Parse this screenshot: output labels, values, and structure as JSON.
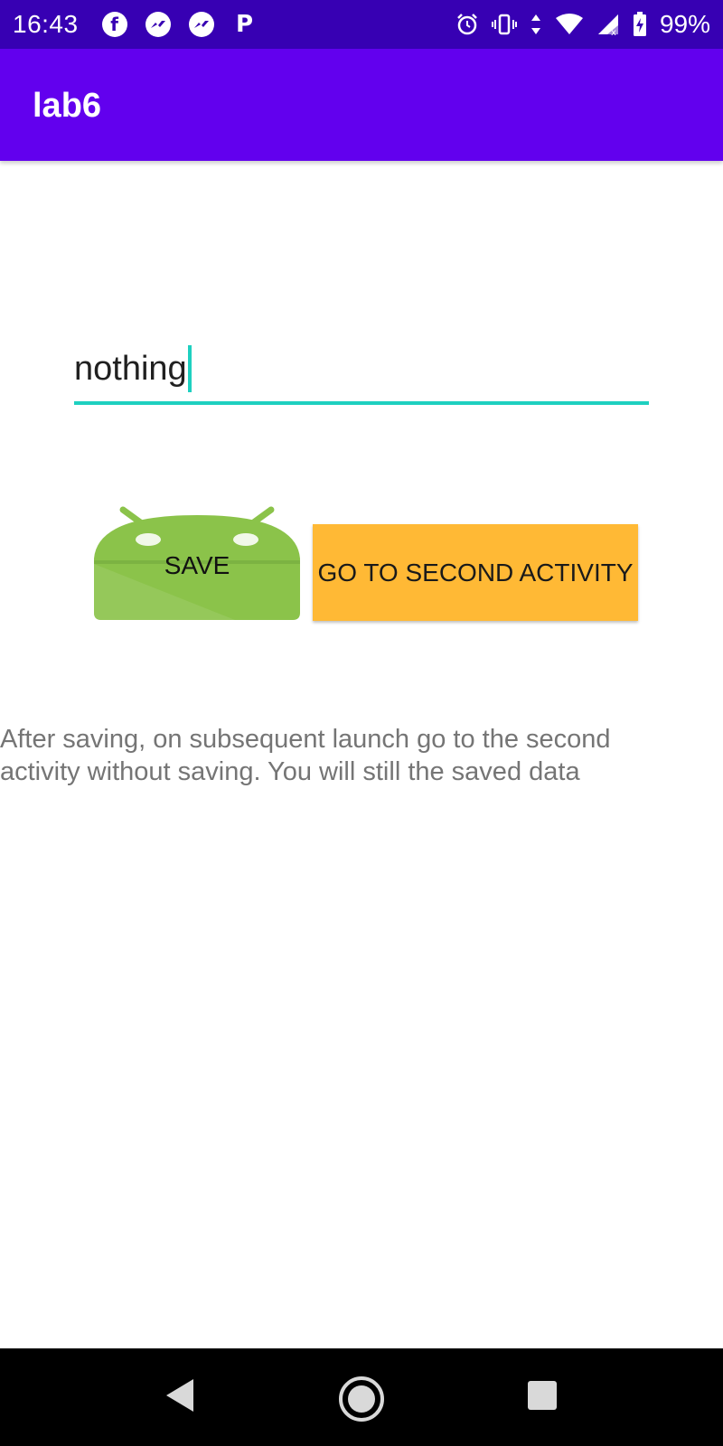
{
  "status_bar": {
    "time": "16:43",
    "notification_icons": [
      "facebook-icon",
      "messenger-icon",
      "messenger-icon",
      "p-icon"
    ],
    "system_icons": [
      "alarm-icon",
      "vibrate-icon",
      "data-arrows-icon",
      "wifi-icon",
      "cell-signal-icon",
      "battery-charging-icon"
    ],
    "battery": "99%"
  },
  "app_bar": {
    "title": "lab6"
  },
  "edit_text": {
    "value": "nothing"
  },
  "buttons": {
    "save_label": "SAVE",
    "second_activity_label": "GO TO SECOND ACTIVITY"
  },
  "info_text": "After saving, on subsequent launch go to the second activity without saving. You will still the saved data",
  "navigation": [
    "back-icon",
    "home-icon",
    "recents-icon"
  ],
  "colors": {
    "status_bar": "#3700b3",
    "app_bar": "#6200ee",
    "accent": "#1ed0c0",
    "second_button": "#ffb935",
    "android_green": "#8bc34a"
  }
}
